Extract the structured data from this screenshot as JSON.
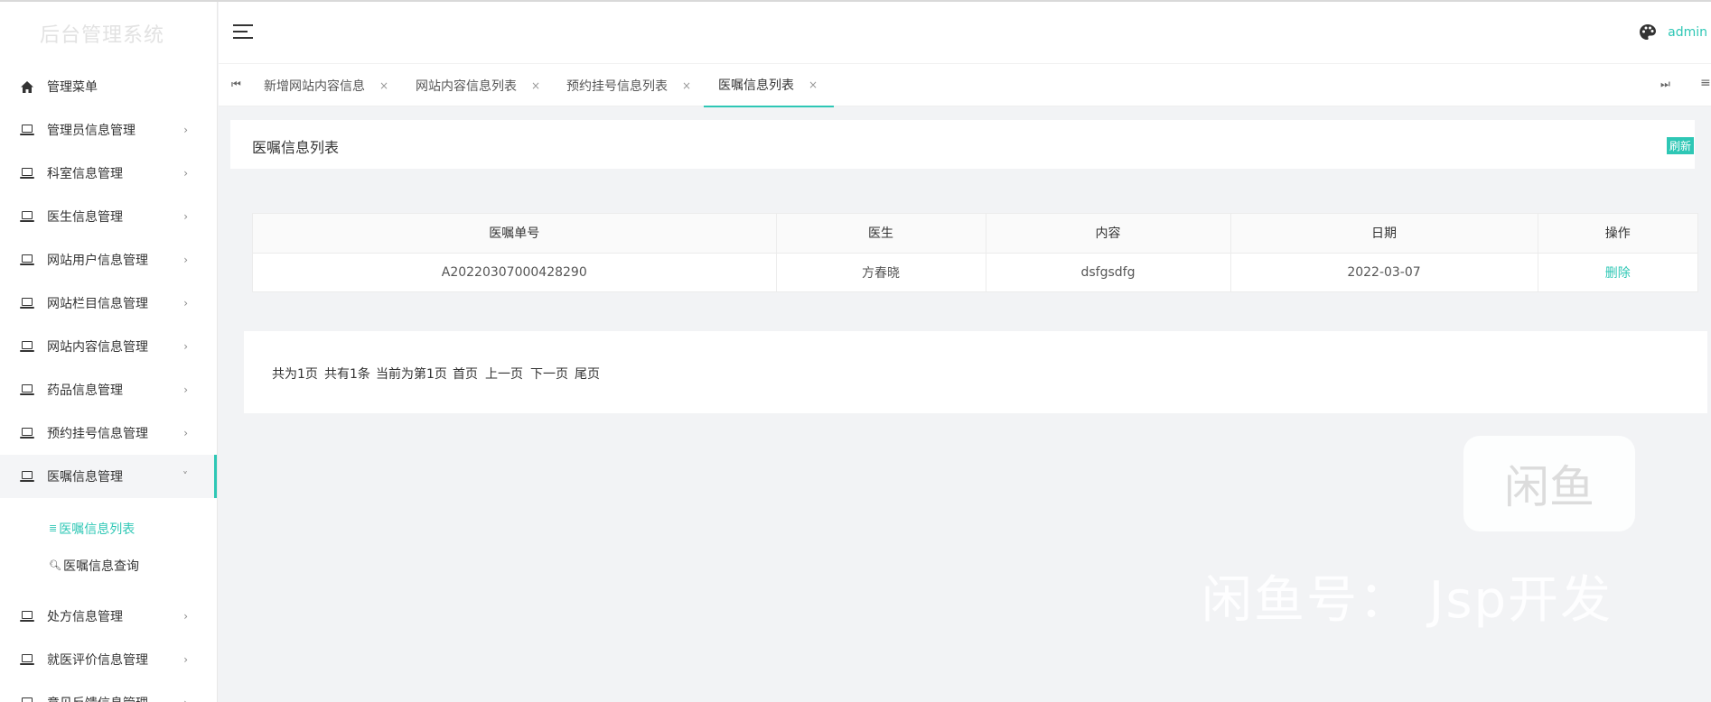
{
  "app": {
    "title": "后台管理系统"
  },
  "header": {
    "user": "admin",
    "icons": [
      "menu-toggle-icon",
      "palette-icon"
    ]
  },
  "sidebar": {
    "items": [
      {
        "label": "管理菜单",
        "icon": "home-icon"
      },
      {
        "label": "管理员信息管理",
        "icon": "laptop-icon"
      },
      {
        "label": "科室信息管理",
        "icon": "laptop-icon"
      },
      {
        "label": "医生信息管理",
        "icon": "laptop-icon"
      },
      {
        "label": "网站用户信息管理",
        "icon": "laptop-icon"
      },
      {
        "label": "网站栏目信息管理",
        "icon": "laptop-icon"
      },
      {
        "label": "网站内容信息管理",
        "icon": "laptop-icon"
      },
      {
        "label": "药品信息管理",
        "icon": "laptop-icon"
      },
      {
        "label": "预约挂号信息管理",
        "icon": "laptop-icon"
      },
      {
        "label": "医嘱信息管理",
        "icon": "laptop-icon",
        "expanded": true
      },
      {
        "label": "处方信息管理",
        "icon": "laptop-icon"
      },
      {
        "label": "就医评价信息管理",
        "icon": "laptop-icon"
      },
      {
        "label": "意见反馈信息管理",
        "icon": "laptop-icon"
      }
    ],
    "subitems": [
      {
        "label": "医嘱信息列表",
        "icon": "list-icon",
        "current": true
      },
      {
        "label": "医嘱信息查询",
        "icon": "search-icon"
      }
    ]
  },
  "tabs": [
    {
      "label": "新增网站内容信息",
      "close": "×"
    },
    {
      "label": "网站内容信息列表",
      "close": "×"
    },
    {
      "label": "预约挂号信息列表",
      "close": "×"
    },
    {
      "label": "医嘱信息列表",
      "close": "×",
      "active": true
    }
  ],
  "tabs_nav": {
    "prev": "⏮",
    "next": "⏭",
    "more": "≡"
  },
  "page": {
    "title": "医嘱信息列表",
    "refresh_label": "刷新"
  },
  "table": {
    "headers": [
      "医嘱单号",
      "医生",
      "内容",
      "日期",
      "操作"
    ],
    "rows": [
      {
        "order_no": "A20220307000428290",
        "doctor": "方春晓",
        "content": "dsfgsdfg",
        "date": "2022-03-07",
        "action": "删除"
      }
    ]
  },
  "pagination": {
    "total_pages": "共为1页",
    "total_records": "共有1条",
    "current": "当前为第1页",
    "first": "首页",
    "prev": "上一页",
    "next": "下一页",
    "last": "尾页"
  },
  "watermark": {
    "logo": "闲鱼",
    "text": "闲鱼号： Jsp开发"
  },
  "colors": {
    "accent": "#2ec7b5",
    "background": "#f2f3f5"
  }
}
